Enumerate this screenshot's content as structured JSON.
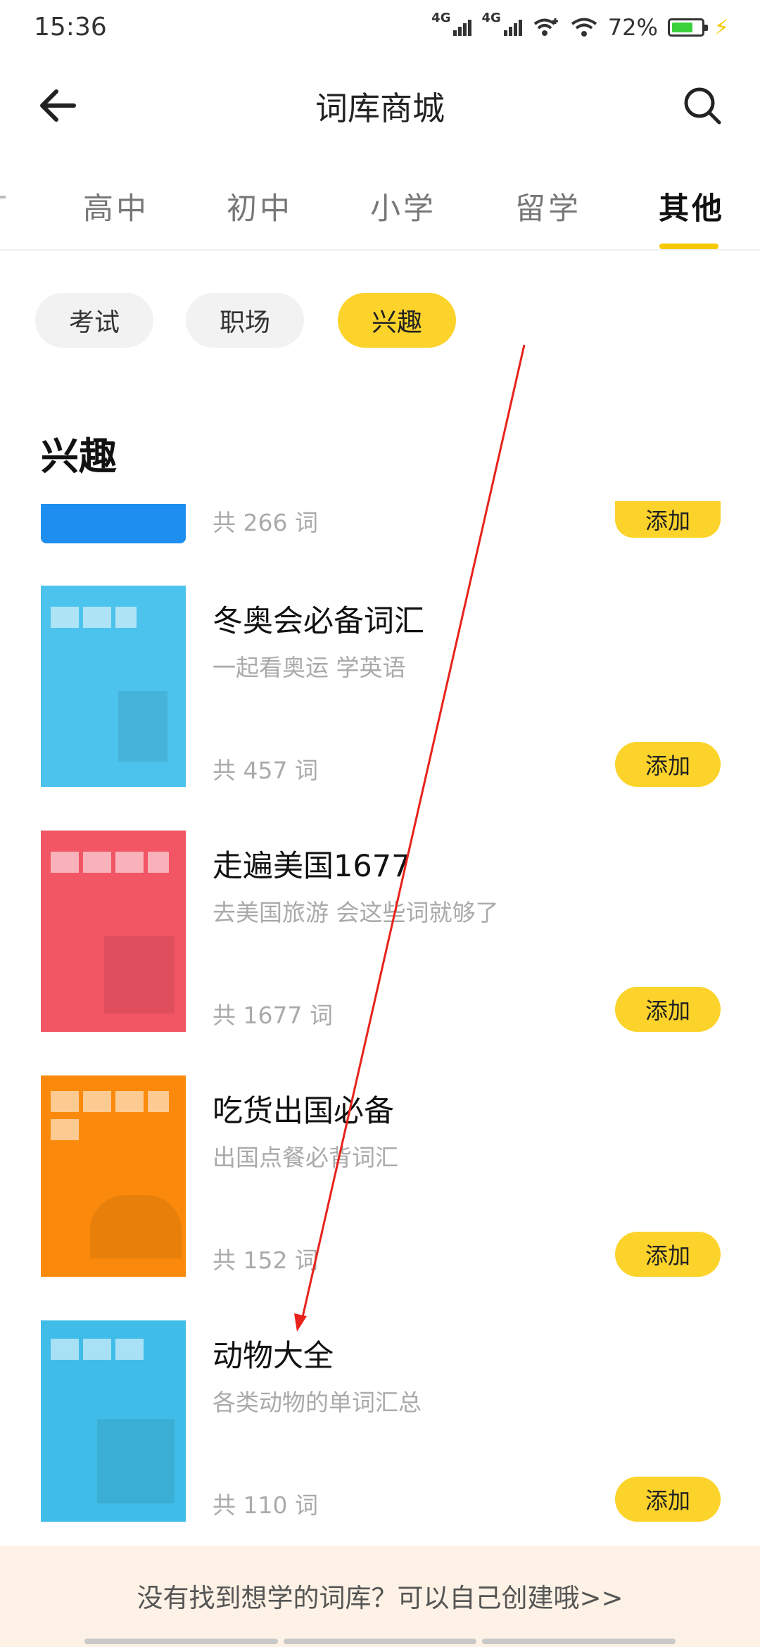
{
  "status": {
    "time": "15:36",
    "net1": "4G",
    "net2": "4G",
    "battery": "72%",
    "battery_level": 0.72
  },
  "header": {
    "title": "词库商城"
  },
  "tabs": [
    "高中",
    "初中",
    "小学",
    "留学",
    "其他"
  ],
  "active_tab": "其他",
  "chips": [
    "考试",
    "职场",
    "兴趣"
  ],
  "active_chip": "兴趣",
  "section": {
    "title": "兴趣"
  },
  "partial_book": {
    "count": "共 266 词",
    "add": "添加"
  },
  "books": [
    {
      "title": "冬奥会必备词汇",
      "desc": "一起看奥运 学英语",
      "count": "共 457 词",
      "add": "添加",
      "cover_color": "#4cc3ec"
    },
    {
      "title": "走遍美国1677",
      "desc": "去美国旅游 会这些词就够了",
      "count": "共 1677 词",
      "add": "添加",
      "cover_color": "#f25564"
    },
    {
      "title": "吃货出国必备",
      "desc": "出国点餐必背词汇",
      "count": "共 152 词",
      "add": "添加",
      "cover_color": "#fb8a0c"
    },
    {
      "title": "动物大全",
      "desc": "各类动物的单词汇总",
      "count": "共 110 词",
      "add": "添加",
      "cover_color": "#3fbde8"
    }
  ],
  "footer": {
    "text": "没有找到想学的词库？可以自己创建哦>>"
  },
  "colors": {
    "accent": "#fcd32b",
    "annotation_arrow": "#e8221c"
  }
}
